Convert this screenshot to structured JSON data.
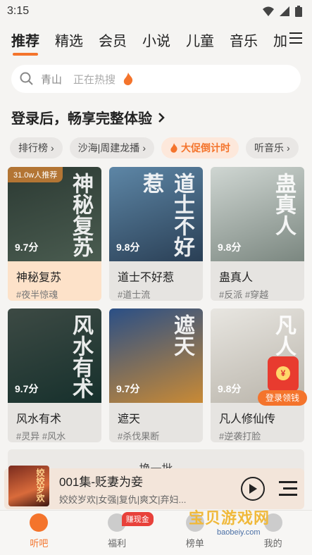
{
  "status_bar": {
    "time": "3:15"
  },
  "top_tabs": [
    "推荐",
    "精选",
    "会员",
    "小说",
    "儿童",
    "音乐",
    "加"
  ],
  "search": {
    "keyword": "青山",
    "hint": "正在热搜"
  },
  "login_banner": {
    "text": "登录后，畅享完整体验"
  },
  "chips": [
    {
      "label": "排行榜",
      "type": "normal"
    },
    {
      "label": "沙海|周建龙播",
      "type": "normal"
    },
    {
      "label": "大促倒计时",
      "type": "promo"
    },
    {
      "label": "听音乐",
      "type": "normal"
    }
  ],
  "books": [
    {
      "title": "神秘复苏",
      "tags": "#夜半惊魂",
      "score": "9.7分",
      "badge": "31.0w人推荐",
      "art": "神秘复苏",
      "colors": [
        "#2c3a33",
        "#4a5c50"
      ],
      "highlight": true
    },
    {
      "title": "道士不好惹",
      "tags": "#道士流",
      "score": "9.8分",
      "art": "道士不好惹",
      "colors": [
        "#5d86a6",
        "#2a3f55"
      ],
      "highlight": false
    },
    {
      "title": "蛊真人",
      "tags": "#反派  #穿越",
      "score": "9.8分",
      "art": "蛊真人",
      "colors": [
        "#cfd6d2",
        "#7b8780"
      ],
      "highlight": false
    },
    {
      "title": "风水有术",
      "tags": "#灵异  #风水",
      "score": "9.7分",
      "art": "风水有术",
      "colors": [
        "#3d4a44",
        "#16302c"
      ],
      "highlight": false
    },
    {
      "title": "遮天",
      "tags": "#杀伐果断",
      "score": "9.7分",
      "art": "遮天",
      "colors": [
        "#2a4f86",
        "#c98a35"
      ],
      "highlight": false
    },
    {
      "title": "凡人修仙传",
      "tags": "#逆袭打脸",
      "score": "9.8分",
      "art": "凡人修仙",
      "colors": [
        "#e8e6e1",
        "#b9b4aa"
      ],
      "highlight": false
    }
  ],
  "refresh_label": "换一批",
  "reward": {
    "label": "登录领钱"
  },
  "now_playing": {
    "title": "001集-贬妻为妾",
    "desc": "姣姣岁欢|女强|复仇|爽文|弃妇...",
    "cover_text": "姣姣岁欢"
  },
  "tabbar": [
    {
      "label": "听吧",
      "active": true
    },
    {
      "label": "福利",
      "badge": "赚现金"
    },
    {
      "label": "榜单"
    },
    {
      "label": "我的"
    }
  ],
  "watermark": {
    "title": "宝贝游戏网",
    "url": "baobeiy.com"
  },
  "colors": {
    "accent": "#f4742c",
    "badge": "#e8413a"
  }
}
